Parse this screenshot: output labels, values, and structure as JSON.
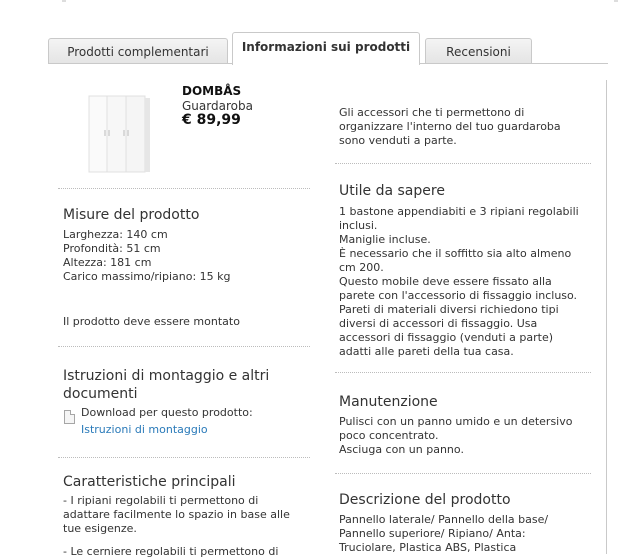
{
  "tabs": [
    {
      "label": "Prodotti complementari"
    },
    {
      "label": "Informazioni sui prodotti"
    },
    {
      "label": "Recensioni"
    }
  ],
  "product": {
    "name": "DOMBÅS",
    "type": "Guardaroba",
    "price": "€ 89,99",
    "image_icon": "wardrobe-image"
  },
  "accessories_note": "Gli accessori che ti permettono di\norganizzare l'interno del tuo guardaroba\nsono venduti a parte.",
  "measures": {
    "title": "Misure del prodotto",
    "lines": "Larghezza: 140 cm\nProfondità: 51 cm\nAltezza: 181 cm\nCarico massimo/ripiano: 15 kg",
    "assembly_note": "Il prodotto deve essere montato"
  },
  "assembly": {
    "title": "Istruzioni di montaggio e altri\ndocumenti",
    "download_label": "Download per questo prodotto:",
    "link_label": "Istruzioni di montaggio"
  },
  "features": {
    "title": "Caratteristiche principali",
    "text1": "- I ripiani regolabili ti permettono di\nadattare facilmente lo spazio in base alle\ntue esigenze.",
    "text2": "- Le cerniere regolabili ti permettono di"
  },
  "good_to_know": {
    "title": "Utile da sapere",
    "text": "1 bastone appendiabiti e 3 ripiani regolabili\ninclusi.\nManiglie incluse.\nÈ necessario che il soffitto sia alto almeno\ncm 200.\nQuesto mobile deve essere fissato alla\nparete con l'accessorio di fissaggio incluso.\nPareti di materiali diversi richiedono tipi\ndiversi di accessori di fissaggio. Usa\naccessori di fissaggio (venduti a parte)\nadatti alle pareti della tua casa."
  },
  "care": {
    "title": "Manutenzione",
    "text": "Pulisci con un panno umido e un detersivo\npoco concentrato.\nAsciuga con un panno."
  },
  "description": {
    "title": "Descrizione del prodotto",
    "text": "Pannello laterale/ Pannello della base/\nPannello superiore/ Ripiano/ Anta:\nTruciolare, Plastica ABS, Plastica"
  },
  "colors": {
    "link": "#2a7ab9",
    "border": "#c9c9c9"
  }
}
